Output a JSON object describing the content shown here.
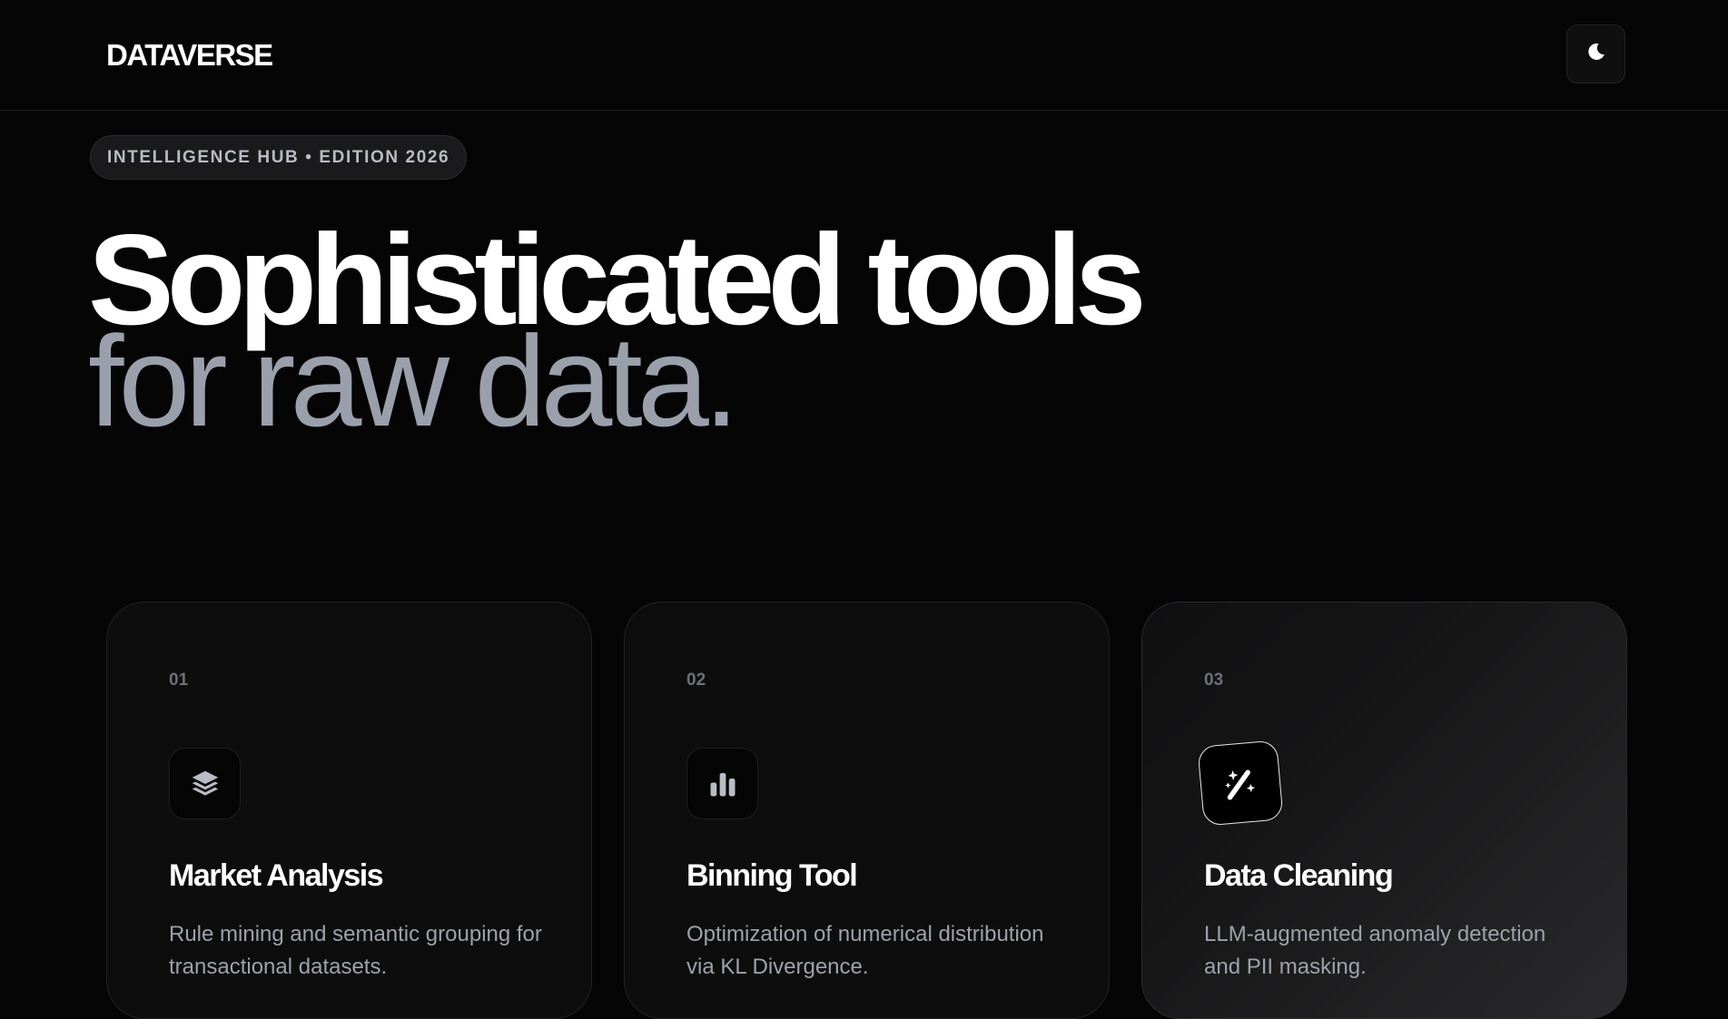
{
  "header": {
    "logo": "DATAVERSE",
    "theme_toggle_icon": "moon-icon"
  },
  "hero": {
    "badge": "INTELLIGENCE HUB • EDITION 2026",
    "headline_line1": "Sophisticated tools",
    "headline_line2": "for raw data."
  },
  "cards": [
    {
      "number": "01",
      "icon": "layers-icon",
      "title": "Market Analysis",
      "description": "Rule mining and semantic grouping for transactional datasets."
    },
    {
      "number": "02",
      "icon": "bar-chart-icon",
      "title": "Binning Tool",
      "description": "Optimization of numerical distribution via KL Divergence."
    },
    {
      "number": "03",
      "icon": "magic-wand-icon",
      "title": "Data Cleaning",
      "description": "LLM-augmented anomaly detection and PII masking."
    }
  ],
  "colors": {
    "background": "#050506",
    "card": "#0d0d0e",
    "headline_secondary": "#9aa0ab",
    "muted_text": "#9da1aa"
  }
}
